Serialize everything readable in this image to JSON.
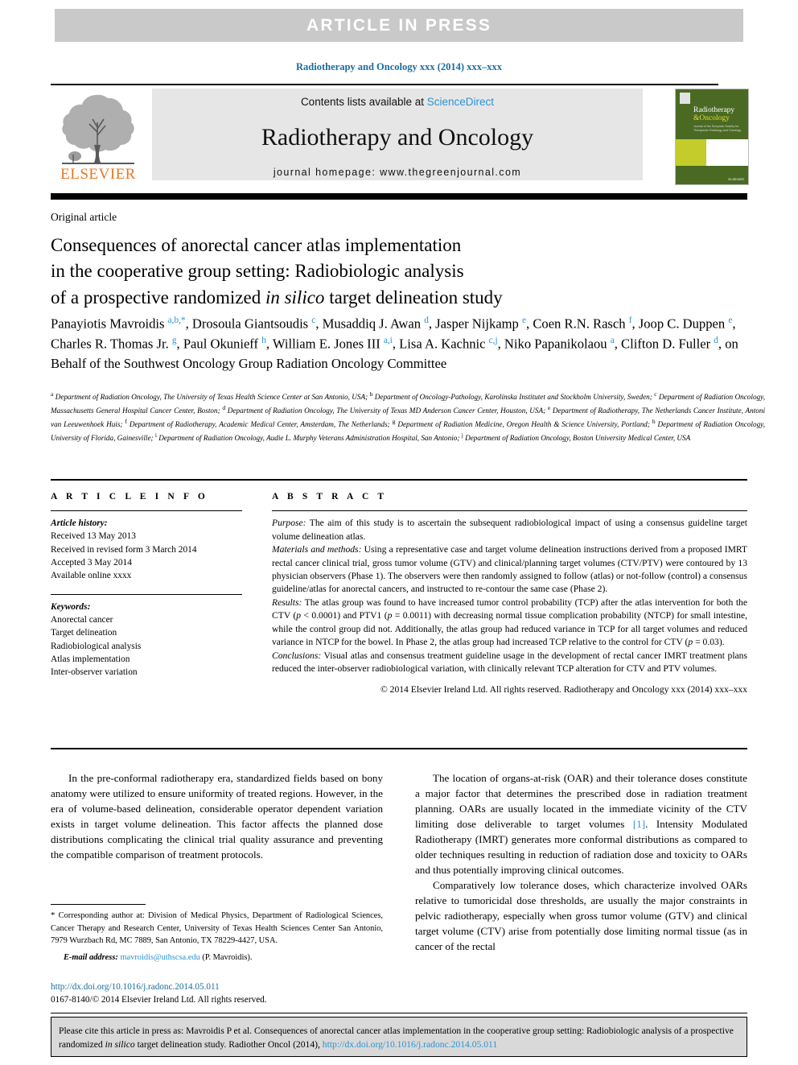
{
  "banner": {
    "text": "ARTICLE  IN  PRESS"
  },
  "running_head": "Radiotherapy and Oncology xxx (2014) xxx–xxx",
  "masthead": {
    "publisher": "ELSEVIER",
    "contents_prefix": "Contents lists available at ",
    "contents_link": "ScienceDirect",
    "journal_title": "Radiotherapy and Oncology",
    "homepage": "journal homepage: www.thegreenjournal.com",
    "cover": {
      "title_line1": "Radiotherapy",
      "title_line2": "&Oncology",
      "subtitle": "Journal of the European Society for\nTherapeutic Radiology and Oncology",
      "publisher_mark": "ELSEVIER"
    }
  },
  "article": {
    "type": "Original article",
    "title_line1": "Consequences of anorectal cancer atlas implementation",
    "title_line2": "in the cooperative group setting: Radiobiologic analysis",
    "title_line3_a": "of a prospective randomized ",
    "title_line3_italic": "in silico",
    "title_line3_b": " target delineation study",
    "authors_html": "Panayiotis Mavroidis <sup>a,b,</sup><sup class=\"star\">*</sup>, Drosoula Giantsoudis <sup>c</sup>, Musaddiq J. Awan <sup>d</sup>, Jasper Nijkamp <sup>e</sup>, Coen R.N. Rasch <sup>f</sup>, Joop C. Duppen <sup>e</sup>, Charles R. Thomas Jr. <sup>g</sup>, Paul Okunieff <sup>h</sup>, William E. Jones III <sup>a,i</sup>, Lisa A. Kachnic <sup>c,j</sup>, Niko Papanikolaou <sup>a</sup>, Clifton D. Fuller <sup>d</sup>, on Behalf of the Southwest Oncology Group Radiation Oncology Committee",
    "affiliations_html": "<sup>a</sup> Department of Radiation Oncology, The University of Texas Health Science Center at San Antonio, USA; <sup>b</sup> Department of Oncology-Pathology, Karolinska Institutet and Stockholm University, Sweden; <sup>c</sup> Department of Radiation Oncology, Massachusetts General Hospital Cancer Center, Boston; <sup>d</sup> Department of Radiation Oncology, The University of Texas MD Anderson Cancer Center, Houston, USA; <sup>e</sup> Department of Radiotherapy, The Netherlands Cancer Institute, Antoni van Leeuwenhoek Huis; <sup>f</sup> Department of Radiotherapy, Academic Medical Center, Amsterdam, The Netherlands; <sup>g</sup> Department of Radiation Medicine, Oregon Health &amp; Science University, Portland; <sup>h</sup> Department of Radiation Oncology, University of Florida, Gainesville; <sup>i</sup> Department of Radiation Oncology, Audie L. Murphy Veterans Administration Hospital, San Antonio; <sup>j</sup> Department of Radiation Oncology, Boston University Medical Center, USA"
  },
  "info": {
    "heading": "A R T I C L E    I N F O",
    "history_label": "Article history:",
    "history": [
      "Received 13 May 2013",
      "Received in revised form 3 March 2014",
      "Accepted 3 May 2014",
      "Available online xxxx"
    ],
    "keywords_label": "Keywords:",
    "keywords": [
      "Anorectal cancer",
      "Target delineation",
      "Radiobiological analysis",
      "Atlas implementation",
      "Inter-observer variation"
    ]
  },
  "abstract": {
    "heading": "A B S T R A C T",
    "purpose_label": "Purpose:",
    "purpose_text": " The aim of this study is to ascertain the subsequent radiobiological impact of using a consensus guideline target volume delineation atlas.",
    "methods_label": "Materials and methods:",
    "methods_text": " Using a representative case and target volume delineation instructions derived from a proposed IMRT rectal cancer clinical trial, gross tumor volume (GTV) and clinical/planning target volumes (CTV/PTV) were contoured by 13 physician observers (Phase 1). The observers were then randomly assigned to follow (atlas) or not-follow (control) a consensus guideline/atlas for anorectal cancers, and instructed to re-contour the same case (Phase 2).",
    "results_label": "Results:",
    "results_html": " The atlas group was found to have increased tumor control probability (TCP) after the atlas intervention for both the CTV (<span class=\"it\">p</span> &lt; 0.0001) and PTV1 (<span class=\"it\">p</span> = 0.0011) with decreasing normal tissue complication probability (NTCP) for small intestine, while the control group did not. Additionally, the atlas group had reduced variance in TCP for all target volumes and reduced variance in NTCP for the bowel. In Phase 2, the atlas group had increased TCP relative to the control for CTV (<span class=\"it\">p</span> = 0.03).",
    "conclusions_label": "Conclusions:",
    "conclusions_text": " Visual atlas and consensus treatment guideline usage in the development of rectal cancer IMRT treatment plans reduced the inter-observer radiobiological variation, with clinically relevant TCP alteration for CTV and PTV volumes.",
    "copyright": "© 2014 Elsevier Ireland Ltd. All rights reserved. Radiotherapy and Oncology xxx (2014) xxx–xxx"
  },
  "body": {
    "left_para_1": "In the pre-conformal radiotherapy era, standardized fields based on bony anatomy were utilized to ensure uniformity of treated regions. However, in the era of volume-based delineation, considerable operator dependent variation exists in target volume delineation. This factor affects the planned dose distributions complicating the clinical trial quality assurance and preventing the compatible comparison of treatment protocols.",
    "right_para_1_html": "The location of organs-at-risk (OAR) and their tolerance doses constitute a major factor that determines the prescribed dose in radiation treatment planning. OARs are usually located in the immediate vicinity of the CTV limiting dose deliverable to target volumes <span class=\"ref-link\">[1]</span>. Intensity Modulated Radiotherapy (IMRT) generates more conformal distributions as compared to older techniques resulting in reduction of radiation dose and toxicity to OARs and thus potentially improving clinical outcomes.",
    "right_para_2": "Comparatively low tolerance doses, which characterize involved OARs relative to tumoricidal dose thresholds, are usually the major constraints in pelvic radiotherapy, especially when gross tumor volume (GTV) and clinical target volume (CTV) arise from potentially dose limiting normal tissue (as in cancer of the rectal"
  },
  "footnote": {
    "corresponding_html": "<span class=\"star\">*</span> Corresponding author at: Division of Medical Physics, Department of Radiological Sciences, Cancer Therapy and Research Center, University of Texas Health Sciences Center San Antonio, 7979 Wurzbach Rd, MC 7889, San Antonio, TX 78229-4427, USA.",
    "email_label": "E-mail address:",
    "email": "mavroidis@uthscsa.edu",
    "email_suffix": " (P. Mavroidis)."
  },
  "doi": {
    "url": "http://dx.doi.org/10.1016/j.radonc.2014.05.011",
    "issn_line": "0167-8140/© 2014 Elsevier Ireland Ltd. All rights reserved."
  },
  "citation": {
    "prefix": "Please cite this article in press as: Mavroidis P et al. Consequences of anorectal cancer atlas implementation in the cooperative group setting: Radiobiologic analysis of a prospective randomized ",
    "italic": "in silico",
    "middle": " target delineation study. Radiother Oncol (2014), ",
    "link": "http://dx.doi.org/10.1016/j.radonc.2014.05.011"
  },
  "colors": {
    "banner_bg": "#c9c9c9",
    "link_blue": "#2a93d5",
    "heading_blue": "#1a6d9e",
    "elsevier_orange": "#e87722",
    "cover_green": "#4a6a23",
    "cover_yellow": "#c3cc2a",
    "panel_gray": "#e6e6e6",
    "cite_bg": "#d9d9d9"
  }
}
